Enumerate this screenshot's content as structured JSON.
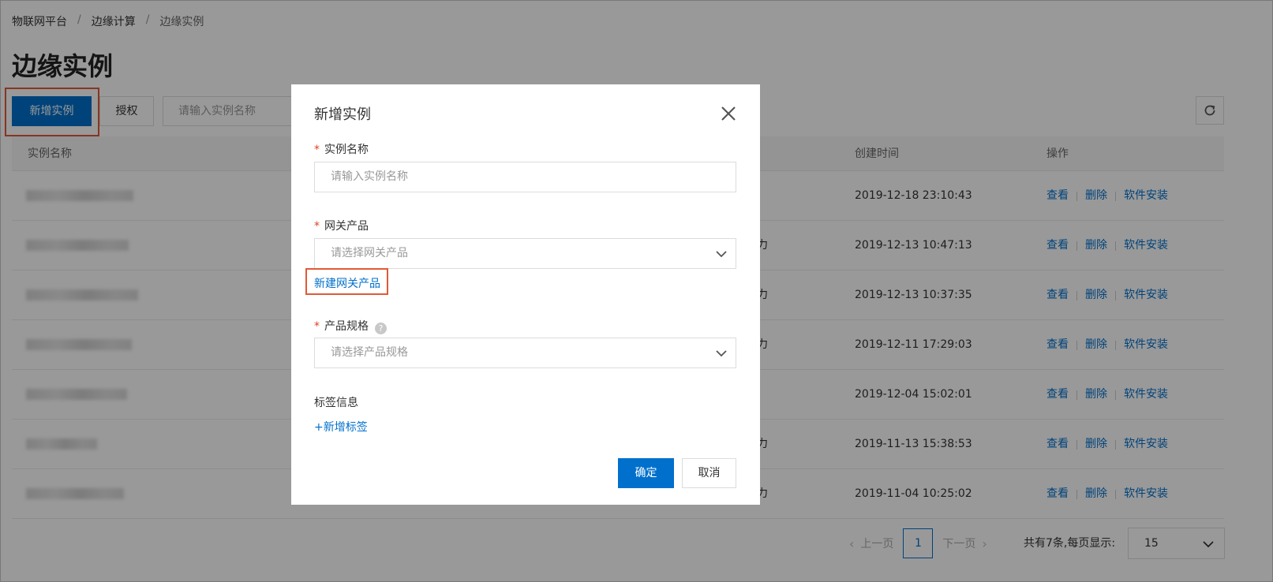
{
  "breadcrumb": [
    "物联网平台",
    "边缘计算",
    "边缘实例"
  ],
  "page_title": "边缘实例",
  "toolbar": {
    "add_label": "新增实例",
    "auth_label": "授权",
    "search_placeholder": "请输入实例名称"
  },
  "table": {
    "headers": [
      "实例名称",
      "创建时间",
      "操作"
    ],
    "rows": [
      {
        "created": "2019-12-18 23:10:43",
        "status_fragment": ""
      },
      {
        "created": "2019-12-13 10:47:13",
        "status_fragment": "力"
      },
      {
        "created": "2019-12-13 10:37:35",
        "status_fragment": "力"
      },
      {
        "created": "2019-12-11 17:29:03",
        "status_fragment": "力"
      },
      {
        "created": "2019-12-04 15:02:01",
        "status_fragment": ""
      },
      {
        "created": "2019-11-13 15:38:53",
        "status_fragment": "力"
      },
      {
        "created": "2019-11-04 10:25:02",
        "status_fragment": "力"
      }
    ],
    "ops": {
      "view": "查看",
      "delete": "删除",
      "install": "软件安装"
    }
  },
  "pager": {
    "prev": "上一页",
    "current": "1",
    "next": "下一页",
    "total_text": "共有7条,每页显示:",
    "page_size": "15"
  },
  "dialog": {
    "title": "新增实例",
    "name_label": "实例名称",
    "name_placeholder": "请输入实例名称",
    "gateway_label": "网关产品",
    "gateway_placeholder": "请选择网关产品",
    "new_gateway_link": "新建网关产品",
    "spec_label": "产品规格",
    "spec_placeholder": "请选择产品规格",
    "tags_label": "标签信息",
    "add_tag_link": "+新增标签",
    "ok_label": "确定",
    "cancel_label": "取消",
    "required_mark": "*"
  },
  "colors": {
    "primary": "#0070cc",
    "highlight": "#e05a37",
    "required": "#e0401f"
  }
}
